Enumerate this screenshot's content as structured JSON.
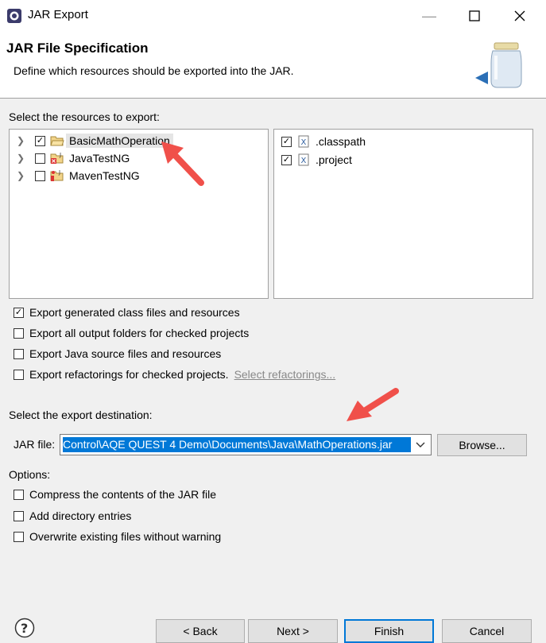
{
  "window": {
    "title": "JAR Export"
  },
  "header": {
    "title": "JAR File Specification",
    "description": "Define which resources should be exported into the JAR."
  },
  "resources": {
    "label": "Select the resources to export:",
    "projects": [
      {
        "name": "BasicMathOperation",
        "checked": true,
        "selected": true
      },
      {
        "name": "JavaTestNG",
        "checked": false,
        "selected": false
      },
      {
        "name": "MavenTestNG",
        "checked": false,
        "selected": false
      }
    ],
    "files": [
      {
        "name": ".classpath",
        "checked": true
      },
      {
        "name": ".project",
        "checked": true
      }
    ]
  },
  "export_options": {
    "generated": "Export generated class files and resources",
    "output_folders": "Export all output folders for checked projects",
    "source_files": "Export Java source files and resources",
    "refactorings": "Export refactorings for checked projects.",
    "select_refactorings": "Select refactorings...",
    "checked": {
      "generated": true,
      "output_folders": false,
      "source_files": false,
      "refactorings": false
    }
  },
  "destination": {
    "label": "Select the export destination:",
    "jar_label": "JAR file:",
    "jar_value": "Control\\AQE QUEST 4 Demo\\Documents\\Java\\MathOperations.jar",
    "browse": "Browse..."
  },
  "options": {
    "label": "Options:",
    "compress": "Compress the contents of the JAR file",
    "directory": "Add directory entries",
    "overwrite": "Overwrite existing files without warning"
  },
  "buttons": {
    "back": "< Back",
    "next": "Next >",
    "finish": "Finish",
    "cancel": "Cancel"
  },
  "colors": {
    "accent": "#0078d7",
    "arrow": "#f0504a"
  }
}
